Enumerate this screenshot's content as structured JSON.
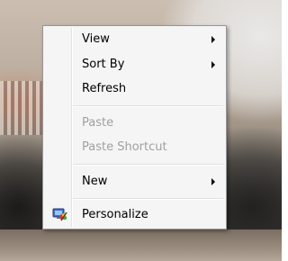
{
  "context_menu": {
    "items": [
      {
        "label": "View",
        "has_submenu": true,
        "enabled": true
      },
      {
        "label": "Sort By",
        "has_submenu": true,
        "enabled": true
      },
      {
        "label": "Refresh",
        "has_submenu": false,
        "enabled": true
      },
      {
        "label": "Paste",
        "has_submenu": false,
        "enabled": false
      },
      {
        "label": "Paste Shortcut",
        "has_submenu": false,
        "enabled": false
      },
      {
        "label": "New",
        "has_submenu": true,
        "enabled": true
      },
      {
        "label": "Personalize",
        "has_submenu": false,
        "enabled": true,
        "icon": "personalize-icon"
      }
    ]
  },
  "colors": {
    "menu_background": "#f5f5f5",
    "menu_border": "#979797",
    "disabled_text": "#a0a0a0",
    "text": "#000000"
  }
}
